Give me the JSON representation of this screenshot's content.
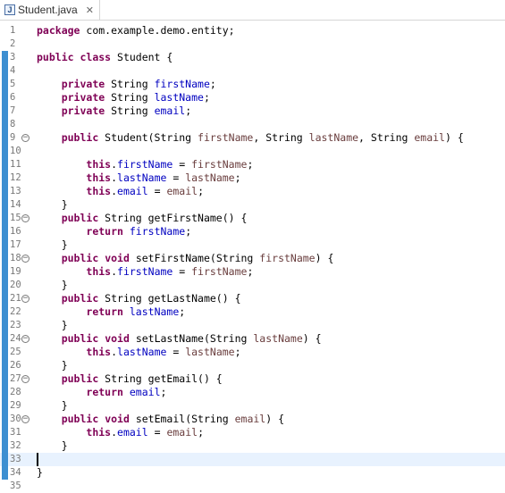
{
  "tab": {
    "title": "Student.java",
    "close": "✕"
  },
  "lines": [
    {
      "n": "1",
      "mark": false,
      "fold": false,
      "tokens": [
        [
          "kw",
          "package"
        ],
        [
          "",
          "com.example.demo.entity;"
        ]
      ]
    },
    {
      "n": "2",
      "mark": false,
      "fold": false,
      "tokens": []
    },
    {
      "n": "3",
      "mark": true,
      "fold": false,
      "tokens": [
        [
          "kw",
          "public"
        ],
        [
          "",
          ""
        ],
        [
          "kw",
          "class"
        ],
        [
          "",
          "Student {"
        ]
      ]
    },
    {
      "n": "4",
      "mark": true,
      "fold": false,
      "tokens": []
    },
    {
      "n": "5",
      "mark": true,
      "fold": false,
      "tokens": [
        [
          "",
          "    "
        ],
        [
          "kw",
          "private"
        ],
        [
          "",
          "String "
        ],
        [
          "fld",
          "firstName"
        ],
        [
          "",
          ";"
        ]
      ]
    },
    {
      "n": "6",
      "mark": true,
      "fold": false,
      "tokens": [
        [
          "",
          "    "
        ],
        [
          "kw",
          "private"
        ],
        [
          "",
          "String "
        ],
        [
          "fld",
          "lastName"
        ],
        [
          "",
          ";"
        ]
      ]
    },
    {
      "n": "7",
      "mark": true,
      "fold": false,
      "tokens": [
        [
          "",
          "    "
        ],
        [
          "kw",
          "private"
        ],
        [
          "",
          "String "
        ],
        [
          "fld",
          "email"
        ],
        [
          "",
          ";"
        ]
      ]
    },
    {
      "n": "8",
      "mark": true,
      "fold": false,
      "tokens": []
    },
    {
      "n": "9",
      "mark": true,
      "fold": true,
      "tokens": [
        [
          "",
          "    "
        ],
        [
          "kw",
          "public"
        ],
        [
          "",
          "Student(String "
        ],
        [
          "prm",
          "firstName"
        ],
        [
          "",
          ", String "
        ],
        [
          "prm",
          "lastName"
        ],
        [
          "",
          ", String "
        ],
        [
          "prm",
          "email"
        ],
        [
          "",
          ") {"
        ]
      ]
    },
    {
      "n": "10",
      "mark": true,
      "fold": false,
      "tokens": []
    },
    {
      "n": "11",
      "mark": true,
      "fold": false,
      "tokens": [
        [
          "",
          "        "
        ],
        [
          "kw",
          "this"
        ],
        [
          "",
          "."
        ],
        [
          "fld",
          "firstName"
        ],
        [
          "",
          " = "
        ],
        [
          "prm",
          "firstName"
        ],
        [
          "",
          ";"
        ]
      ]
    },
    {
      "n": "12",
      "mark": true,
      "fold": false,
      "tokens": [
        [
          "",
          "        "
        ],
        [
          "kw",
          "this"
        ],
        [
          "",
          "."
        ],
        [
          "fld",
          "lastName"
        ],
        [
          "",
          " = "
        ],
        [
          "prm",
          "lastName"
        ],
        [
          "",
          ";"
        ]
      ]
    },
    {
      "n": "13",
      "mark": true,
      "fold": false,
      "tokens": [
        [
          "",
          "        "
        ],
        [
          "kw",
          "this"
        ],
        [
          "",
          "."
        ],
        [
          "fld",
          "email"
        ],
        [
          "",
          " = "
        ],
        [
          "prm",
          "email"
        ],
        [
          "",
          ";"
        ]
      ]
    },
    {
      "n": "14",
      "mark": true,
      "fold": false,
      "tokens": [
        [
          "",
          "    }"
        ]
      ]
    },
    {
      "n": "15",
      "mark": true,
      "fold": true,
      "tokens": [
        [
          "",
          "    "
        ],
        [
          "kw",
          "public"
        ],
        [
          "",
          "String getFirstName() {"
        ]
      ]
    },
    {
      "n": "16",
      "mark": true,
      "fold": false,
      "tokens": [
        [
          "",
          "        "
        ],
        [
          "kw",
          "return"
        ],
        [
          "",
          " "
        ],
        [
          "fld",
          "firstName"
        ],
        [
          "",
          ";"
        ]
      ]
    },
    {
      "n": "17",
      "mark": true,
      "fold": false,
      "tokens": [
        [
          "",
          "    }"
        ]
      ]
    },
    {
      "n": "18",
      "mark": true,
      "fold": true,
      "tokens": [
        [
          "",
          "    "
        ],
        [
          "kw",
          "public"
        ],
        [
          "",
          " "
        ],
        [
          "kw",
          "void"
        ],
        [
          "",
          "setFirstName(String "
        ],
        [
          "prm",
          "firstName"
        ],
        [
          "",
          ") {"
        ]
      ]
    },
    {
      "n": "19",
      "mark": true,
      "fold": false,
      "tokens": [
        [
          "",
          "        "
        ],
        [
          "kw",
          "this"
        ],
        [
          "",
          "."
        ],
        [
          "fld",
          "firstName"
        ],
        [
          "",
          " = "
        ],
        [
          "prm",
          "firstName"
        ],
        [
          "",
          ";"
        ]
      ]
    },
    {
      "n": "20",
      "mark": true,
      "fold": false,
      "tokens": [
        [
          "",
          "    }"
        ]
      ]
    },
    {
      "n": "21",
      "mark": true,
      "fold": true,
      "tokens": [
        [
          "",
          "    "
        ],
        [
          "kw",
          "public"
        ],
        [
          "",
          "String getLastName() {"
        ]
      ]
    },
    {
      "n": "22",
      "mark": true,
      "fold": false,
      "tokens": [
        [
          "",
          "        "
        ],
        [
          "kw",
          "return"
        ],
        [
          "",
          " "
        ],
        [
          "fld",
          "lastName"
        ],
        [
          "",
          ";"
        ]
      ]
    },
    {
      "n": "23",
      "mark": true,
      "fold": false,
      "tokens": [
        [
          "",
          "    }"
        ]
      ]
    },
    {
      "n": "24",
      "mark": true,
      "fold": true,
      "tokens": [
        [
          "",
          "    "
        ],
        [
          "kw",
          "public"
        ],
        [
          "",
          " "
        ],
        [
          "kw",
          "void"
        ],
        [
          "",
          "setLastName(String "
        ],
        [
          "prm",
          "lastName"
        ],
        [
          "",
          ") {"
        ]
      ]
    },
    {
      "n": "25",
      "mark": true,
      "fold": false,
      "tokens": [
        [
          "",
          "        "
        ],
        [
          "kw",
          "this"
        ],
        [
          "",
          "."
        ],
        [
          "fld",
          "lastName"
        ],
        [
          "",
          " = "
        ],
        [
          "prm",
          "lastName"
        ],
        [
          "",
          ";"
        ]
      ]
    },
    {
      "n": "26",
      "mark": true,
      "fold": false,
      "tokens": [
        [
          "",
          "    }"
        ]
      ]
    },
    {
      "n": "27",
      "mark": true,
      "fold": true,
      "tokens": [
        [
          "",
          "    "
        ],
        [
          "kw",
          "public"
        ],
        [
          "",
          "String getEmail() {"
        ]
      ]
    },
    {
      "n": "28",
      "mark": true,
      "fold": false,
      "tokens": [
        [
          "",
          "        "
        ],
        [
          "kw",
          "return"
        ],
        [
          "",
          " "
        ],
        [
          "fld",
          "email"
        ],
        [
          "",
          ";"
        ]
      ]
    },
    {
      "n": "29",
      "mark": true,
      "fold": false,
      "tokens": [
        [
          "",
          "    }"
        ]
      ]
    },
    {
      "n": "30",
      "mark": true,
      "fold": true,
      "tokens": [
        [
          "",
          "    "
        ],
        [
          "kw",
          "public"
        ],
        [
          "",
          " "
        ],
        [
          "kw",
          "void"
        ],
        [
          "",
          "setEmail(String "
        ],
        [
          "prm",
          "email"
        ],
        [
          "",
          ") {"
        ]
      ]
    },
    {
      "n": "31",
      "mark": true,
      "fold": false,
      "tokens": [
        [
          "",
          "        "
        ],
        [
          "kw",
          "this"
        ],
        [
          "",
          "."
        ],
        [
          "fld",
          "email"
        ],
        [
          "",
          " = "
        ],
        [
          "prm",
          "email"
        ],
        [
          "",
          ";"
        ]
      ]
    },
    {
      "n": "32",
      "mark": true,
      "fold": false,
      "tokens": [
        [
          "",
          "    }"
        ]
      ]
    },
    {
      "n": "33",
      "mark": true,
      "fold": false,
      "current": true,
      "tokens": []
    },
    {
      "n": "34",
      "mark": true,
      "fold": false,
      "tokens": [
        [
          "",
          "}"
        ]
      ]
    },
    {
      "n": "35",
      "mark": false,
      "fold": false,
      "tokens": []
    }
  ]
}
